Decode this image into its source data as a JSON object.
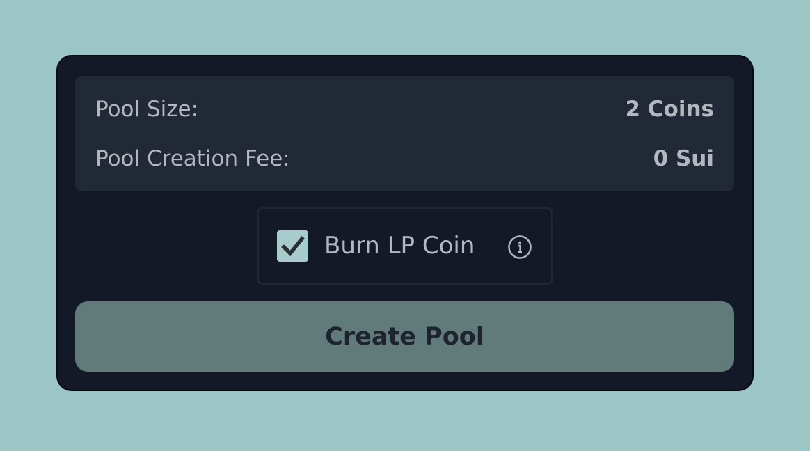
{
  "pool_info": {
    "size_label": "Pool Size:",
    "size_value": "2 Coins",
    "fee_label": "Pool Creation Fee:",
    "fee_value": "0 Sui"
  },
  "burn_lp": {
    "checked": true,
    "label": "Burn LP Coin",
    "icon": "info-icon"
  },
  "create_button": {
    "label": "Create Pool"
  },
  "colors": {
    "background": "#9cc6c6",
    "card": "#131926",
    "panel": "#212836",
    "checkbox": "#a8cccc",
    "button": "#617a7a",
    "text": "#b4b8be"
  }
}
